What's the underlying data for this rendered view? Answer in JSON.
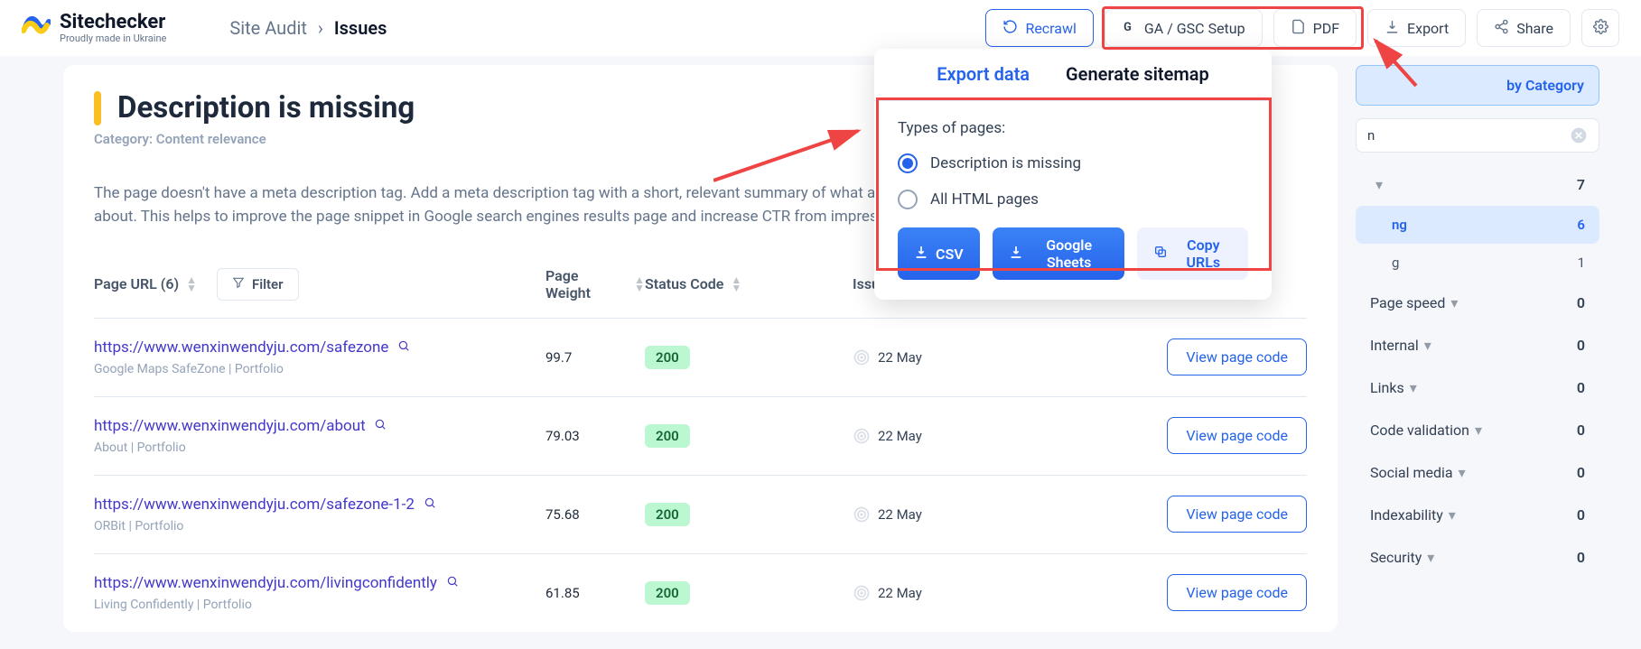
{
  "header": {
    "brand": "Sitechecker",
    "brand_sub": "Proudly made in Ukraine",
    "breadcrumb_root": "Site Audit",
    "breadcrumb_sep": "›",
    "breadcrumb_current": "Issues",
    "recrawl": "Recrawl",
    "ga_gsc": "GA / GSC Setup",
    "pdf": "PDF",
    "export": "Export",
    "share": "Share"
  },
  "issue": {
    "title": "Description is missing",
    "category_label": "Category: Content relevance",
    "description": "The page doesn't have a meta description tag. Add a meta description tag with a short, relevant summary of what a specific page is about. This helps to improve the page snippet in Google search engines results page and increase CTR from impressions to clicks."
  },
  "table": {
    "page_url_header": "Page URL (6)",
    "filter": "Filter",
    "page_weight": "Page Weight",
    "status_code": "Status Code",
    "issue_found": "Issue Found",
    "view_btn": "View page code",
    "rows": [
      {
        "url": "https://www.wenxinwendyju.com/safezone",
        "sub": "Google Maps SafeZone | Portfolio",
        "weight": "99.7",
        "status": "200",
        "found": "22 May"
      },
      {
        "url": "https://www.wenxinwendyju.com/about",
        "sub": "About | Portfolio",
        "weight": "79.03",
        "status": "200",
        "found": "22 May"
      },
      {
        "url": "https://www.wenxinwendyju.com/safezone-1-2",
        "sub": "ORBit | Portfolio",
        "weight": "75.68",
        "status": "200",
        "found": "22 May"
      },
      {
        "url": "https://www.wenxinwendyju.com/livingconfidently",
        "sub": "Living Confidently | Portfolio",
        "weight": "61.85",
        "status": "200",
        "found": "22 May"
      }
    ]
  },
  "sidebar": {
    "by_category": "by Category",
    "search_text": "n",
    "items": [
      {
        "label": "",
        "count": "7",
        "expanded": true
      },
      {
        "label": "ng",
        "count": "6",
        "highlight": true,
        "sub": true
      },
      {
        "label": "g",
        "count": "1",
        "sub": true
      },
      {
        "label": "Page speed",
        "count": "0"
      },
      {
        "label": "Internal",
        "count": "0"
      },
      {
        "label": "Links",
        "count": "0"
      },
      {
        "label": "Code validation",
        "count": "0"
      },
      {
        "label": "Social media",
        "count": "0"
      },
      {
        "label": "Indexability",
        "count": "0"
      },
      {
        "label": "Security",
        "count": "0"
      }
    ]
  },
  "export_popup": {
    "tab_export": "Export data",
    "tab_sitemap": "Generate sitemap",
    "types_label": "Types of pages:",
    "opt1": "Description is missing",
    "opt2": "All HTML pages",
    "csv": "CSV",
    "sheets": "Google Sheets",
    "copy_urls": "Copy URLs"
  }
}
